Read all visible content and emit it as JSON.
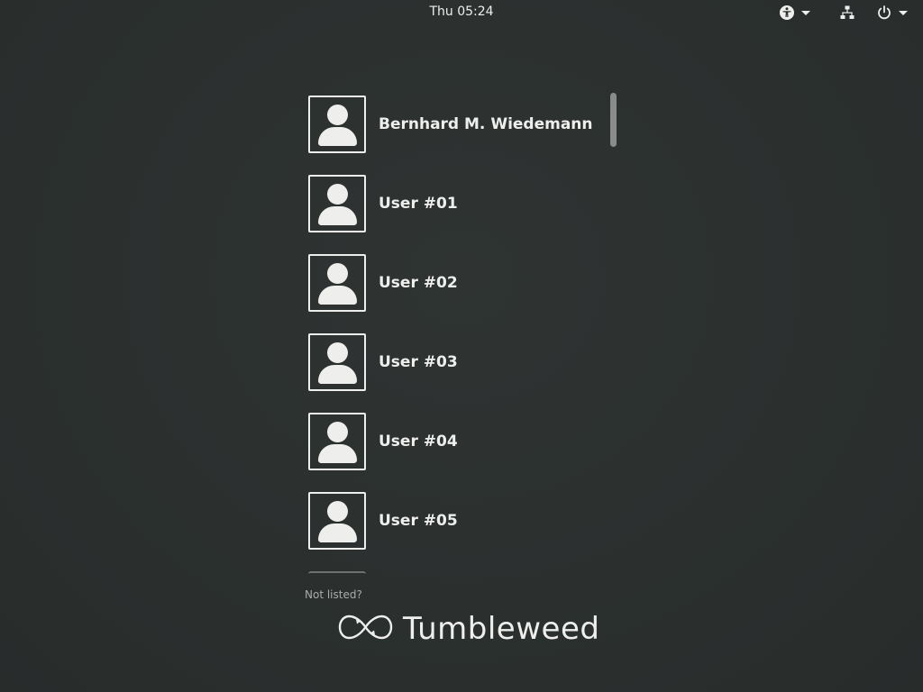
{
  "topbar": {
    "clock": "Thu 05:24",
    "tray": [
      {
        "icon": "accessibility-icon"
      },
      {
        "icon": "network-wired-icon"
      },
      {
        "icon": "power-icon"
      }
    ]
  },
  "users": [
    {
      "name": "Bernhard M. Wiedemann",
      "icon": "user-avatar-icon"
    },
    {
      "name": "User #01",
      "icon": "user-avatar-icon"
    },
    {
      "name": "User #02",
      "icon": "user-avatar-icon"
    },
    {
      "name": "User #03",
      "icon": "user-avatar-icon"
    },
    {
      "name": "User #04",
      "icon": "user-avatar-icon"
    },
    {
      "name": "User #05",
      "icon": "user-avatar-icon"
    }
  ],
  "not_listed": "Not listed?",
  "branding": {
    "name": "Tumbleweed",
    "icon": "tumbleweed-logo-icon"
  },
  "colors": {
    "background": "#2c3130",
    "foreground": "#eeeeec",
    "muted": "#a9acaa"
  }
}
